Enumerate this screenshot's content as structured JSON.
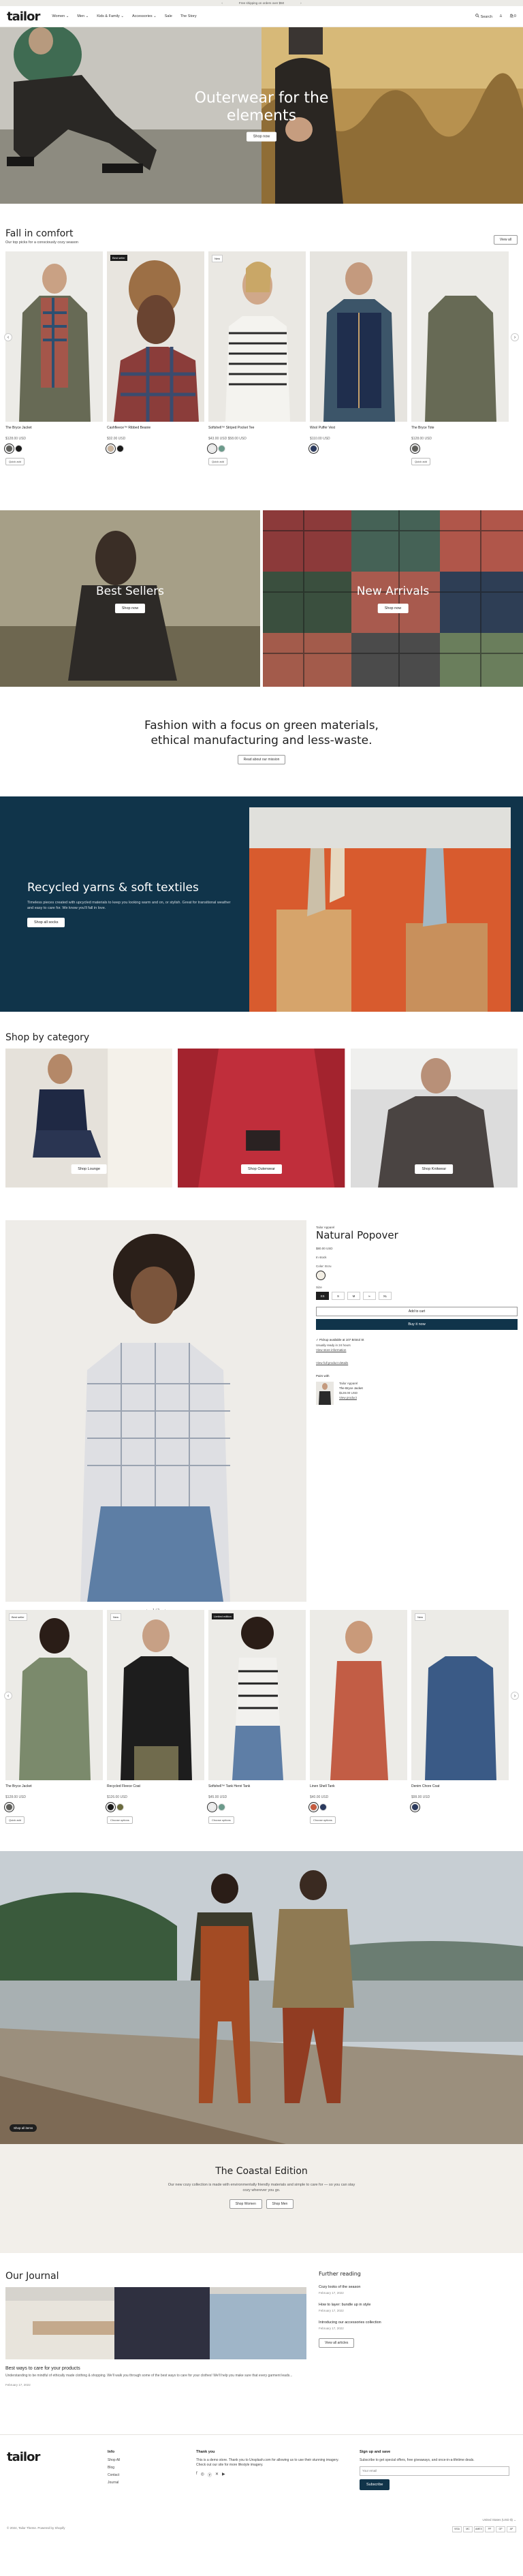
{
  "announcement": {
    "text": "Free shipping on orders over $50",
    "prev": "‹",
    "next": "›"
  },
  "header": {
    "logo": "tailor",
    "nav": [
      "Women ⌄",
      "Men ⌄",
      "Kids & Family ⌄",
      "Accessories ⌄",
      "Sale",
      "The Story"
    ],
    "search": "Search",
    "account": "♙",
    "cart": "🛍0"
  },
  "hero": {
    "title": "Outerwear for the elements",
    "button": "Shop now"
  },
  "fall": {
    "title": "Fall in comfort",
    "subtitle": "Our top picks for a consciously cozy season",
    "view_all": "View all",
    "products": [
      {
        "badge": "",
        "name": "The Bryce Jacket",
        "price": "$128.00 USD",
        "colors": [
          "#5f5f5b",
          "#1a1a1a"
        ],
        "button": "Quick add"
      },
      {
        "badge": "Best seller",
        "name": "Cashfleece™ Ribbed Beanie",
        "price": "$32.00 USD",
        "colors": [
          "#c8b29b",
          "#1a1a1a"
        ],
        "button": "Choose options"
      },
      {
        "badge": "New",
        "name": "Softshell™ Striped Pocket Tee",
        "price": "$43.00 USD $58.00 USD",
        "colors": [
          "#eeeeee",
          "#6c9a8b"
        ],
        "button": "Quick add"
      },
      {
        "badge": "",
        "name": "Wool Puffer Vest",
        "price": "$110.00 USD",
        "colors": [
          "#2b3a5e"
        ],
        "button": "Choose options"
      },
      {
        "badge": "",
        "name": "The Bryce Tote",
        "price": "$128.00 USD",
        "colors": [
          "#5f5f5b"
        ],
        "button": "Quick add"
      }
    ]
  },
  "banners": {
    "left": {
      "title": "Best Sellers",
      "button": "Shop now"
    },
    "right": {
      "title": "New Arrivals",
      "button": "Shop now"
    }
  },
  "mission": {
    "title": "Fashion with a focus on green materials, ethical manufacturing and less-waste.",
    "button": "Read about our mission"
  },
  "recycled": {
    "title": "Recycled yarns & soft textiles",
    "body": "Timeless pieces created with upcycled materials to keep you looking warm and on, or stylish. Great for transitional weather and easy to care for. We know you'll fall in love.",
    "button": "Shop all socks"
  },
  "categories": {
    "title": "Shop by category",
    "items": [
      {
        "label": "Shop Lounge"
      },
      {
        "label": "Shop Outerwear"
      },
      {
        "label": "Shop Knitwear"
      }
    ]
  },
  "featured": {
    "vendor": "Tailor Apparel",
    "title": "Natural Popover",
    "price": "$80.00 USD",
    "stock": "In stock",
    "color_label": "Color: Ecru",
    "size_label": "Size",
    "sizes": [
      "XS",
      "S",
      "M",
      "L",
      "XL"
    ],
    "add_to_cart": "Add to cart",
    "buy_now": "Buy it now",
    "pickup": "✓ Pickup available at 107 Bristol St",
    "pickup_note": "Usually ready in 24 hours",
    "store_info": "View store information",
    "view_details": "View full product details",
    "pair_label": "Pairs with",
    "pair_vendor": "Tailor Apparel",
    "pair_name": "The Bryce Jacket",
    "pair_price": "$128.00 USD",
    "pair_link": "View product",
    "pager": {
      "prev": "‹",
      "count": "1 / 2",
      "next": "›"
    }
  },
  "products2": [
    {
      "badge": "Best seller",
      "name": "The Bryce Jacket",
      "price": "$128.00 USD",
      "colors": [
        "#5f5f5b"
      ],
      "button": "Quick add"
    },
    {
      "badge": "New",
      "name": "Recycled Fleece Coat",
      "price": "$126.00 USD",
      "colors": [
        "#1a1a1a",
        "#6b6b3e"
      ],
      "button": "Choose options"
    },
    {
      "badge": "Limited edition",
      "name": "Softshell™ Tank Henri Tank",
      "price": "$45.00 USD",
      "colors": [
        "#eeeeee",
        "#6c9a8b"
      ],
      "button": "Choose options"
    },
    {
      "badge": "",
      "name": "Linen Shell Tank",
      "price": "$40.00 USD",
      "colors": [
        "#c55a3e",
        "#2b3a5e"
      ],
      "button": "Choose options"
    },
    {
      "badge": "New",
      "name": "Denim Chore Coat",
      "price": "$99.00 USD",
      "colors": [
        "#2b3a5e"
      ],
      "button": "Quick add"
    }
  ],
  "coastal": {
    "tag": "Shop all items",
    "title": "The Coastal Edition",
    "body": "Our new cozy collection is made with environmentally friendly materials and simple to care for — so you can stay cozy wherever you go.",
    "button1": "Shop Women",
    "button2": "Shop Men"
  },
  "journal": {
    "title": "Our Journal",
    "main_title": "Best ways to care for your products",
    "main_excerpt": "Understanding to be mindful of ethically made clothing & shopping. We'll walk you through some of the best ways to care for your clothes! We'll help you make sure that every garment leads...",
    "main_date": "February 17, 2022",
    "side_title": "Further reading",
    "links": [
      {
        "title": "Cozy looks of the season",
        "date": "February 17, 2022"
      },
      {
        "title": "How to layer: bundle up in style",
        "date": "February 17, 2022"
      },
      {
        "title": "Introducing our accessories collection",
        "date": "February 17, 2022"
      }
    ],
    "view_all": "View all articles"
  },
  "footer": {
    "logo": "tailor",
    "info_title": "Info",
    "info_links": [
      "Shop All",
      "Blog",
      "Contact",
      "Journal"
    ],
    "thanks_title": "Thank you",
    "thanks_body": "This is a demo store. Thank you to Unsplash.com for allowing us to use their stunning imagery. Check out our site for more lifestyle imagery.",
    "signup_title": "Sign up and save",
    "signup_body": "Subscribe to get special offers, free giveaways, and once-in-a-lifetime deals.",
    "email_placeholder": "Your email",
    "subscribe": "Subscribe",
    "country": "United States (USD $) ⌄",
    "copyright": "© 2024, Tailor Theme. Powered by Shopify",
    "payments": [
      "VISA",
      "MC",
      "AMEX",
      "PP",
      "GP",
      "AP"
    ]
  }
}
